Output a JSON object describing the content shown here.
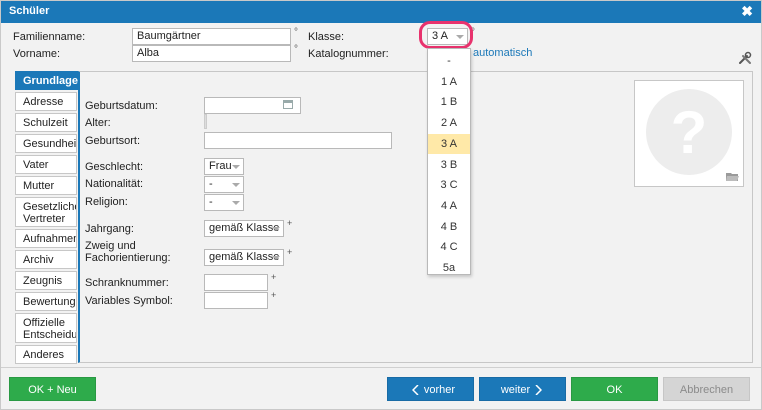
{
  "window": {
    "title": "Schüler",
    "close_icon": "close-icon",
    "close_glyph": "✖"
  },
  "header": {
    "familienname_label": "Familienname:",
    "familienname_value": "Baumgärtner",
    "vorname_label": "Vorname:",
    "vorname_value": "Alba",
    "degree_mark": "°",
    "klasse_label": "Klasse:",
    "klasse_value": "3 A",
    "katalog_label": "Katalognummer:",
    "katalog_link": "automatisch",
    "tools_icon": "tools-icon"
  },
  "klasse_dropdown": {
    "options": [
      "-",
      "1 A",
      "1 B",
      "2 A",
      "3 A",
      "3 B",
      "3 C",
      "4 A",
      "4 B",
      "4 C",
      "5a"
    ],
    "selected": "3 A"
  },
  "sidebar": {
    "items": [
      {
        "label": "Grundlagen",
        "active": true
      },
      {
        "label": "Adresse"
      },
      {
        "label": "Schulzeit"
      },
      {
        "label": "Gesundheit"
      },
      {
        "label": "Vater"
      },
      {
        "label": "Mutter"
      },
      {
        "label": "Gesetzlicher",
        "label2": "Vertreter"
      },
      {
        "label": "Aufnahmen"
      },
      {
        "label": "Archiv"
      },
      {
        "label": "Zeugnis"
      },
      {
        "label": "Bewertung"
      },
      {
        "label": "Offizielle",
        "label2": "Entscheidun"
      },
      {
        "label": "Anderes"
      }
    ]
  },
  "form": {
    "geburtsdatum_label": "Geburtsdatum:",
    "geburtsdatum_value": "",
    "calendar_icon": "calendar-icon",
    "alter_label": "Alter:",
    "geburtsort_label": "Geburtsort:",
    "geburtsort_value": "",
    "geschlecht_label": "Geschlecht:",
    "geschlecht_value": "Frau",
    "nationalitaet_label": "Nationalität:",
    "nationalitaet_value": "-",
    "religion_label": "Religion:",
    "religion_value": "-",
    "jahrgang_label": "Jahrgang:",
    "jahrgang_value": "gemäß Klasse",
    "zweig_label_1": "Zweig und",
    "zweig_label_2": "Fachorientierung:",
    "zweig_value": "gemäß Klasse",
    "schrank_label": "Schranknummer:",
    "schrank_value": "",
    "vs_label": "Variables Symbol:",
    "vs_value": "",
    "plus_mark": "+"
  },
  "photo": {
    "placeholder_icon": "question-mark-icon",
    "folder_icon": "folder-icon"
  },
  "footer": {
    "ok_neu": "OK + Neu",
    "vorher": "vorher",
    "weiter": "weiter",
    "ok": "OK",
    "abbrechen": "Abbrechen"
  },
  "colors": {
    "accent": "#1b78b8",
    "green": "#2eab4b",
    "highlight_ring": "#e8326d",
    "selected_option": "#ffe9a8"
  }
}
